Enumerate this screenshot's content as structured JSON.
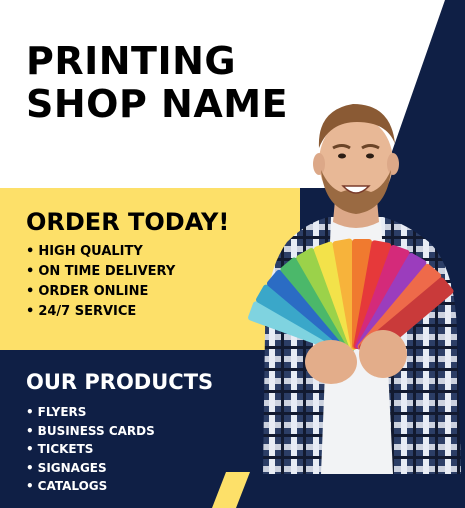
{
  "header": {
    "title_line1": "PRINTING",
    "title_line2": "SHOP NAME"
  },
  "order": {
    "heading": "ORDER TODAY!",
    "features": [
      "HIGH QUALITY",
      "ON TIME DELIVERY",
      "ORDER ONLINE",
      "24/7 SERVICE"
    ]
  },
  "products": {
    "heading": "OUR PRODUCTS",
    "items": [
      "FLYERS",
      "BUSINESS CARDS",
      "TICKETS",
      "SIGNAGES",
      "CATALOGS"
    ]
  },
  "bullet": "•",
  "colors": {
    "navy": "#0f1f45",
    "yellow": "#fde069",
    "white": "#ffffff",
    "black": "#000000"
  }
}
